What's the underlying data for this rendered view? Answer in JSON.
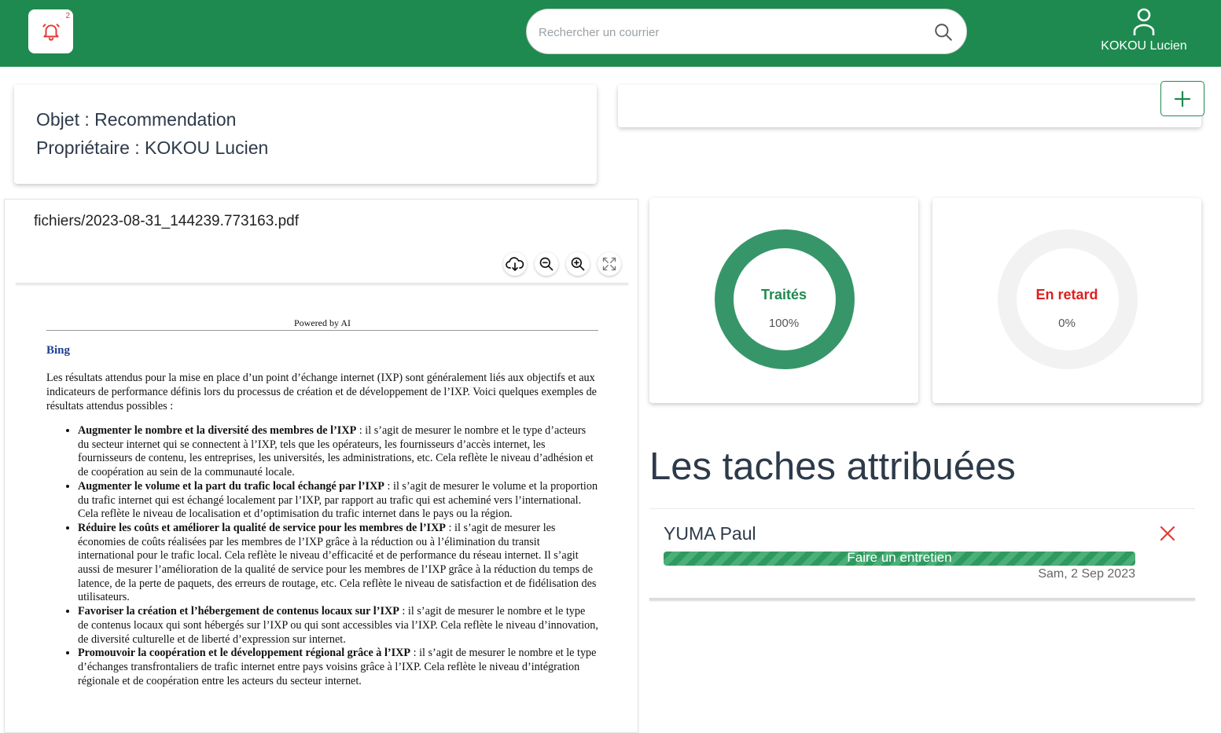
{
  "header": {
    "notifications": {
      "count": "2"
    },
    "search": {
      "placeholder": "Rechercher un courrier",
      "value": ""
    },
    "user": {
      "name": "KOKOU Lucien"
    },
    "color": "#1e8a4f"
  },
  "mail": {
    "object_label": "Objet : Recommendation",
    "owner_label": "Propriétaire : KOKOU Lucien"
  },
  "viewer": {
    "file_name": "fichiers/2023-08-31_144239.773163.pdf",
    "tools": [
      "download-icon",
      "zoom-out-icon",
      "zoom-in-icon",
      "fullscreen-icon"
    ],
    "document": {
      "header": "Powered by AI",
      "source": "Bing",
      "intro": "Les résultats attendus pour la mise en place d’un point d’échange internet (IXP) sont généralement liés aux objectifs et aux indicateurs de performance définis lors du processus de création et de développement de l’IXP. Voici quelques exemples de résultats attendus possibles :",
      "items": [
        {
          "title": "Augmenter le nombre et la diversité des membres de l’IXP",
          "text": " : il s’agit de mesurer le nombre et le type d’acteurs du secteur internet qui se connectent à l’IXP, tels que les opérateurs, les fournisseurs d’accès internet, les fournisseurs de contenu, les entreprises, les universités, les administrations, etc. Cela reflète le niveau d’adhésion et de coopération au sein de la communauté locale."
        },
        {
          "title": "Augmenter le volume et la part du trafic local échangé par l’IXP",
          "text": " : il s’agit de mesurer le volume et la proportion du trafic internet qui est échangé localement par l’IXP, par rapport au trafic qui est acheminé vers l’international. Cela reflète le niveau de localisation et d’optimisation du trafic internet dans le pays ou la région."
        },
        {
          "title": "Réduire les coûts et améliorer la qualité de service pour les membres de l’IXP",
          "text": " : il s’agit de mesurer les économies de coûts réalisées par les membres de l’IXP grâce à la réduction ou à l’élimination du transit international pour le trafic local. Cela reflète le niveau d’efficacité et de performance du réseau internet. Il s’agit aussi de mesurer l’amélioration de la qualité de service pour les membres de l’IXP grâce à la réduction du temps de latence, de la perte de paquets, des erreurs de routage, etc. Cela reflète le niveau de satisfaction et de fidélisation des utilisateurs."
        },
        {
          "title": "Favoriser la création et l’hébergement de contenus locaux sur l’IXP",
          "text": " : il s’agit de mesurer le nombre et le type de contenus locaux qui sont hébergés sur l’IXP ou qui sont accessibles via l’IXP. Cela reflète le niveau d’innovation, de diversité culturelle et de liberté d’expression sur internet."
        },
        {
          "title": "Promouvoir la coopération et le développement régional grâce à l’IXP",
          "text": " : il s’agit de mesurer le nombre et le type d’échanges transfrontaliers de trafic internet entre pays voisins grâce à l’IXP. Cela reflète le niveau d’intégration régionale et de coopération entre les acteurs du secteur internet."
        }
      ]
    }
  },
  "stats": [
    {
      "label": "Traités",
      "percent_text": "100%",
      "value": 100,
      "color": "#36966a",
      "label_color": "#1e8a4f"
    },
    {
      "label": "En retard",
      "percent_text": "0%",
      "value": 0,
      "color": "#e01e1e",
      "label_color": "#e01e1e"
    }
  ],
  "tasks": {
    "title": "Les taches attribuées",
    "items": [
      {
        "assignee": "YUMA Paul",
        "task": "Faire un entretien",
        "progress": 1.0,
        "date": "Sam, 2 Sep 2023"
      }
    ]
  }
}
